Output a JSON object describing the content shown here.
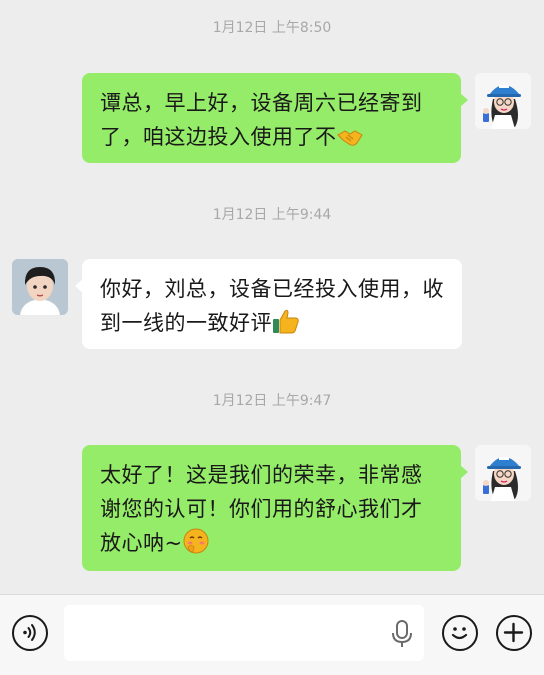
{
  "messages": [
    {
      "timestamp": "1月12日 上午8:50",
      "side": "right",
      "text": "谭总，早上好，设备周六已经寄到了，咱这边投入使用了不",
      "emoji": "handshake-emoji"
    },
    {
      "timestamp": "1月12日 上午9:44",
      "side": "left",
      "text": "你好，刘总，设备已经投入使用，收到一线的一致好评",
      "emoji": "thumbs-up-emoji"
    },
    {
      "timestamp": "1月12日 上午9:47",
      "side": "right",
      "text": "太好了！这是我们的荣幸，非常感谢您的认可！你们用的舒心我们才放心呐~",
      "emoji": "blushing-face-emoji"
    }
  ],
  "input_bar": {
    "placeholder": "",
    "voice_icon": "voice-icon",
    "mic_icon": "microphone-icon",
    "emoji_icon": "emoji-smiley-icon",
    "plus_icon": "plus-icon"
  },
  "colors": {
    "background": "#ededed",
    "outgoing_bubble": "#95ec69",
    "incoming_bubble": "#ffffff",
    "timestamp_text": "#a8a8a8"
  }
}
